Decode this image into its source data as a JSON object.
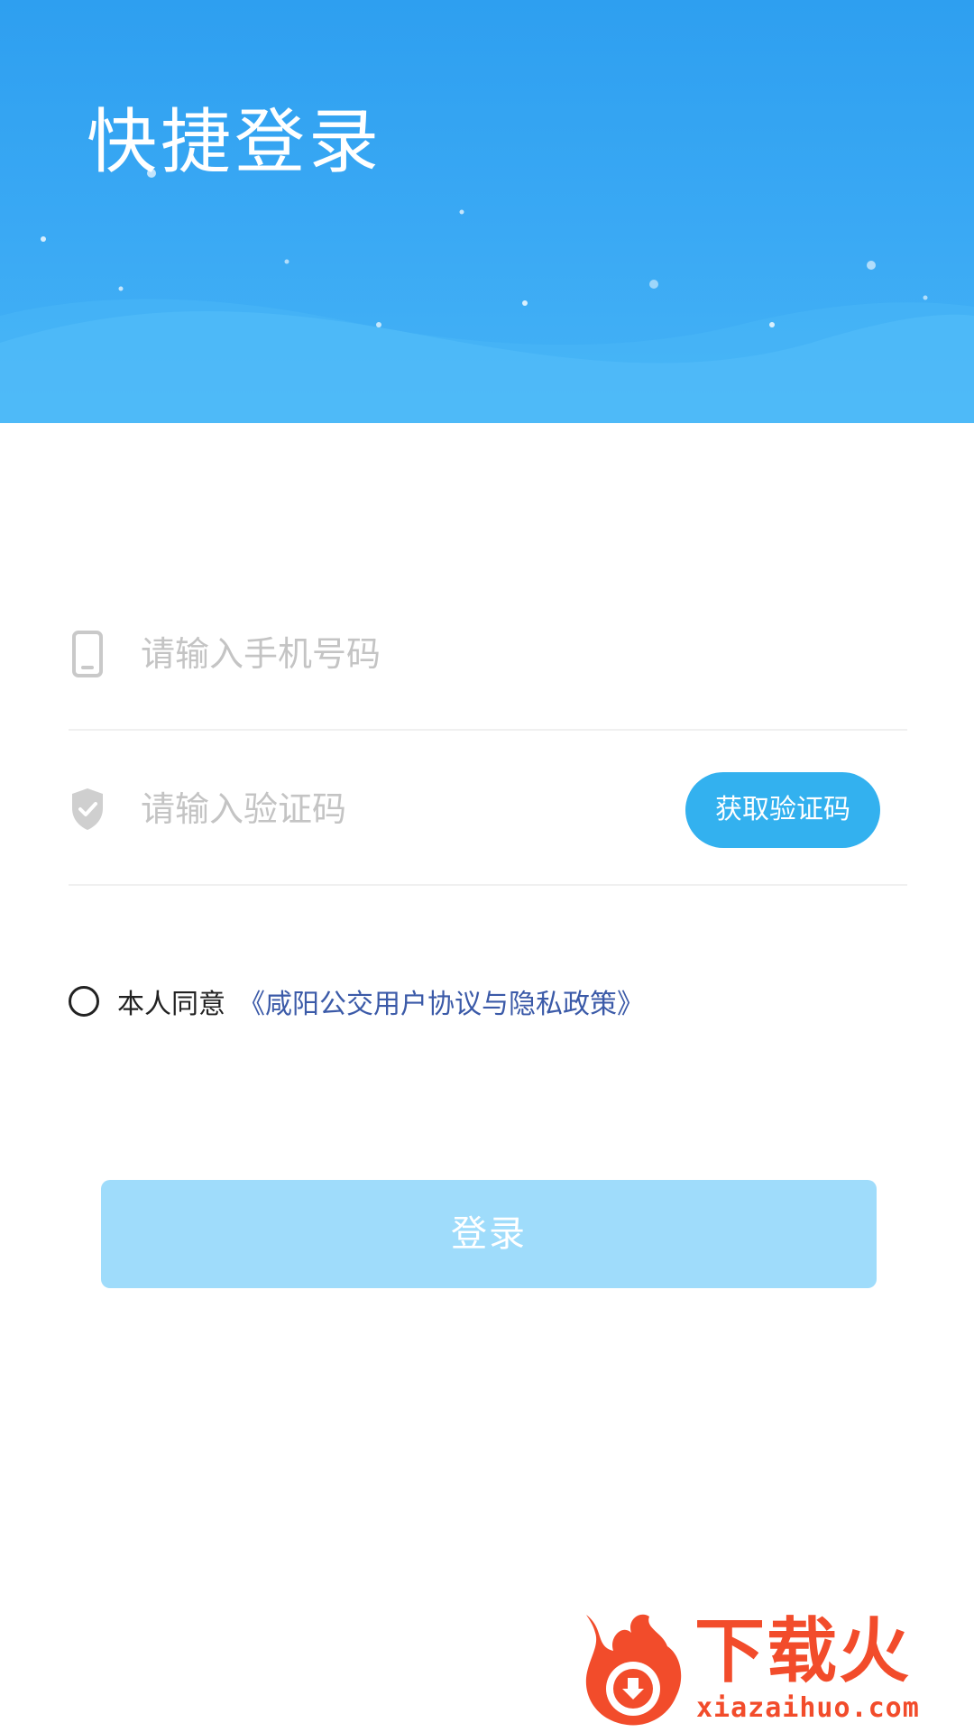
{
  "header": {
    "title": "快捷登录"
  },
  "form": {
    "phone": {
      "icon": "phone-icon",
      "placeholder": "请输入手机号码",
      "value": ""
    },
    "code": {
      "icon": "shield-check-icon",
      "placeholder": "请输入验证码",
      "value": "",
      "get_code_label": "获取验证码"
    }
  },
  "agreement": {
    "checked": false,
    "prefix": "本人同意",
    "link_text": "《咸阳公交用户协议与隐私政策》"
  },
  "login": {
    "label": "登录"
  },
  "watermark": {
    "brand": "下载火",
    "site": "xiazaihuo.com"
  },
  "colors": {
    "header_blue": "#2e9ff0",
    "button_blue": "#33b1ef",
    "login_disabled": "#9fdcfb",
    "link_blue": "#3b5aa8",
    "watermark_orange": "#f24c2b"
  }
}
